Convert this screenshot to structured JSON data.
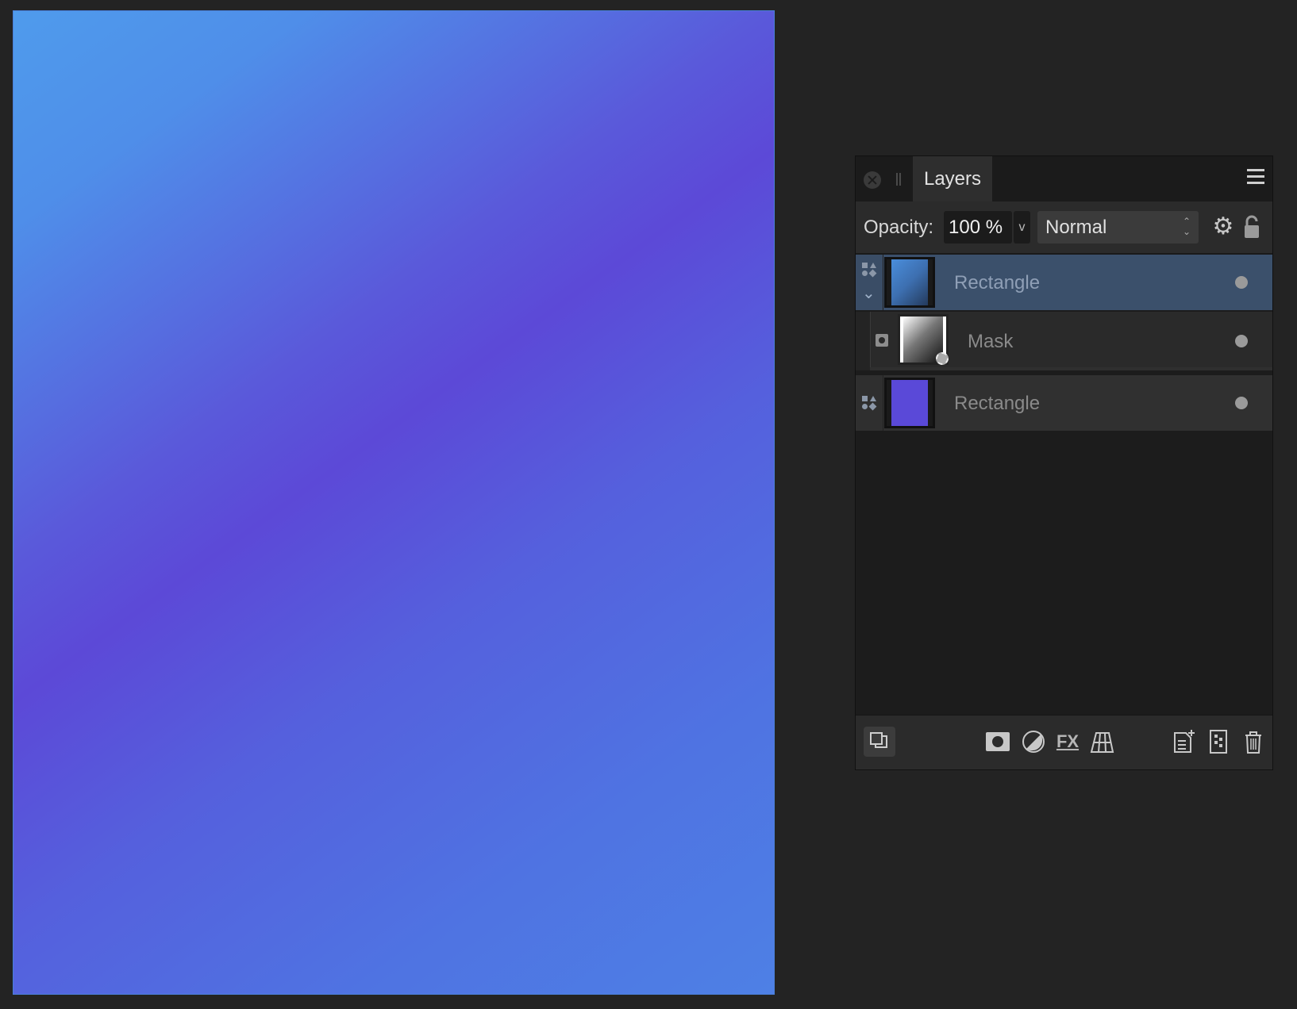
{
  "canvas": {
    "gradient_colors": [
      "#4f9bec",
      "#5c49d7",
      "#4e80e5"
    ]
  },
  "panel": {
    "tab_title": "Layers",
    "opacity_label": "Opacity:",
    "opacity_value": "100 %",
    "opacity_dropdown_glyph": "v",
    "blend_mode": "Normal",
    "blend_arrows": "⌃⌄",
    "gear_glyph": "⚙",
    "expand_glyph": "⌄"
  },
  "layers": [
    {
      "name": "Rectangle",
      "selected": true,
      "type": "shape",
      "thumb": "gradient-blue"
    },
    {
      "name": "Mask",
      "selected": false,
      "type": "mask",
      "thumb": "gradient-mask"
    },
    {
      "name": "Rectangle",
      "selected": false,
      "type": "shape",
      "thumb": "solid-purple"
    }
  ],
  "bottom_bar": {
    "icons": [
      "layer-stack-icon",
      "mask-icon",
      "adjustment-icon",
      "fx-icon",
      "mesh-warp-icon",
      "add-layer-icon",
      "pixel-layer-icon",
      "trash-icon"
    ],
    "fx_label": "FX"
  }
}
